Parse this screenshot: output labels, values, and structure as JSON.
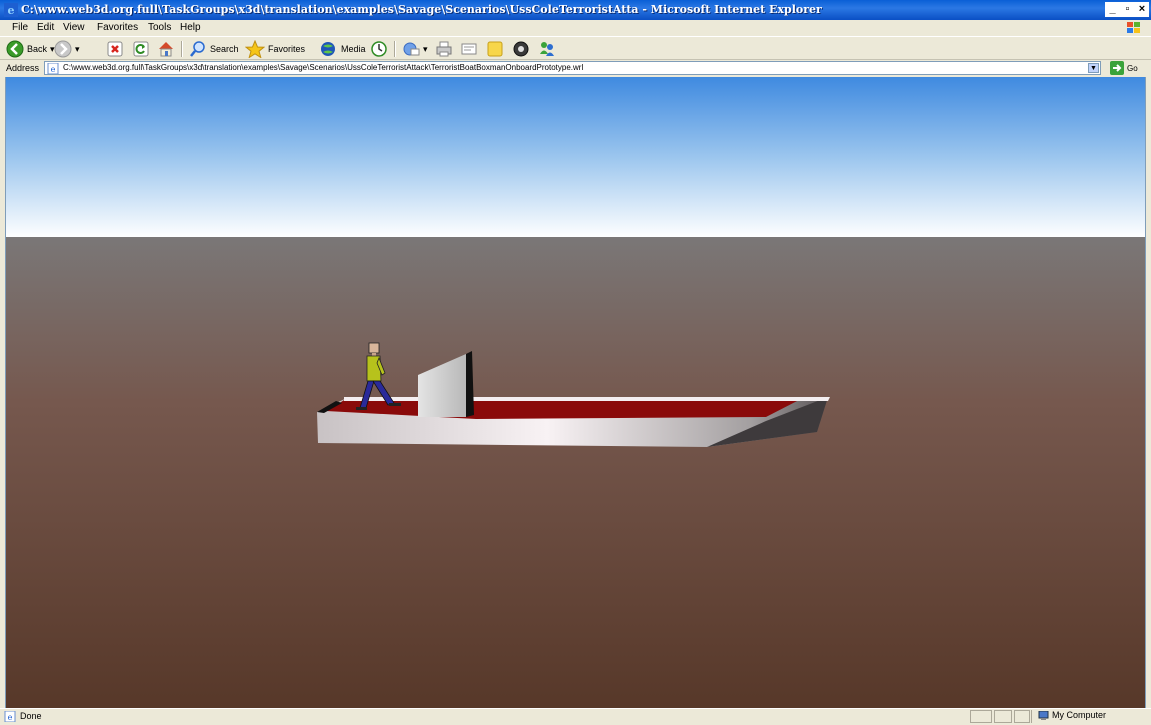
{
  "window": {
    "title": "C:\\www.web3d.org.full\\TaskGroups\\x3d\\translation\\examples\\Savage\\Scenarios\\UssColeTerroristAtta - Microsoft Internet Explorer",
    "minimize": "_",
    "maximize": "▫",
    "close": "×"
  },
  "menu": {
    "file": "File",
    "edit": "Edit",
    "view": "View",
    "favorites": "Favorites",
    "tools": "Tools",
    "help": "Help"
  },
  "toolbar": {
    "back": "Back",
    "search": "Search",
    "favorites": "Favorites",
    "media": "Media"
  },
  "address": {
    "label": "Address",
    "url": "C:\\www.web3d.org.full\\TaskGroups\\x3d\\translation\\examples\\Savage\\Scenarios\\UssColeTerroristAttack\\TerroristBoatBoxmanOnboardPrototype.wrl",
    "go": "Go"
  },
  "status": {
    "text": "Done",
    "zone": "My Computer"
  },
  "colors": {
    "sky_top": "#3f8ae0",
    "sky_horizon": "#ffffff",
    "ground_top": "#7a7777",
    "ground_bottom": "#573829",
    "deck": "#8a0a0a",
    "hull": "#e8e2e4"
  },
  "icons": {
    "title": "ie-icon",
    "back": "back-arrow-icon",
    "forward": "forward-arrow-icon",
    "stop": "stop-icon",
    "refresh": "refresh-icon",
    "home": "home-icon",
    "search": "search-icon",
    "favorites": "star-icon",
    "media": "media-icon",
    "history": "history-icon",
    "mail": "mail-icon",
    "print": "print-icon",
    "edit": "edit-icon",
    "discuss": "discuss-icon",
    "messenger": "messenger-icon",
    "research": "research-icon"
  }
}
